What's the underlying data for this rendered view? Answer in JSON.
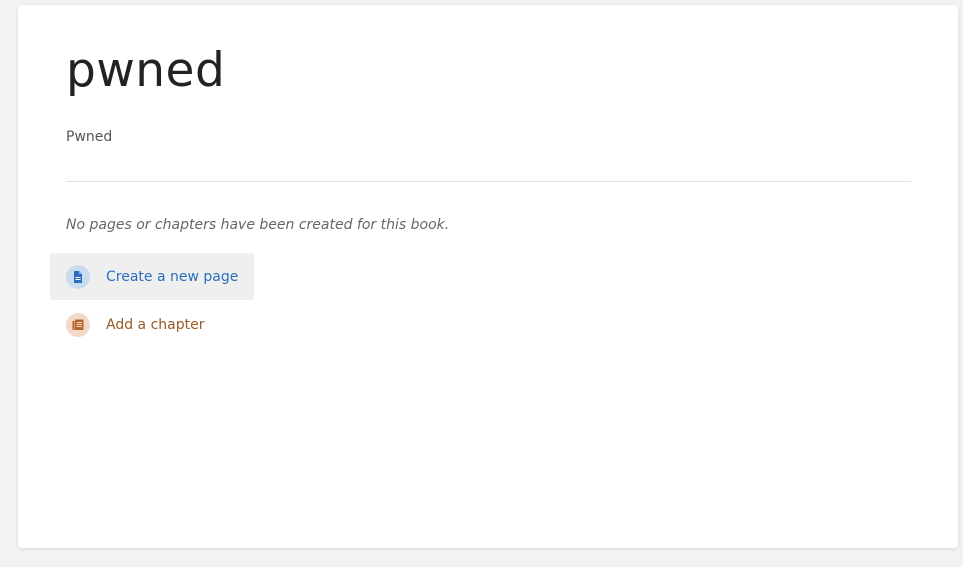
{
  "book": {
    "title": "pwned",
    "description": "Pwned"
  },
  "empty_state": {
    "message": "No pages or chapters have been created for this book."
  },
  "actions": {
    "new_page": {
      "label": "Create a new page",
      "icon": "page-icon",
      "color": "#2a6fbf"
    },
    "add_chapter": {
      "label": "Add a chapter",
      "icon": "chapter-icon",
      "color": "#9a5a22"
    }
  }
}
